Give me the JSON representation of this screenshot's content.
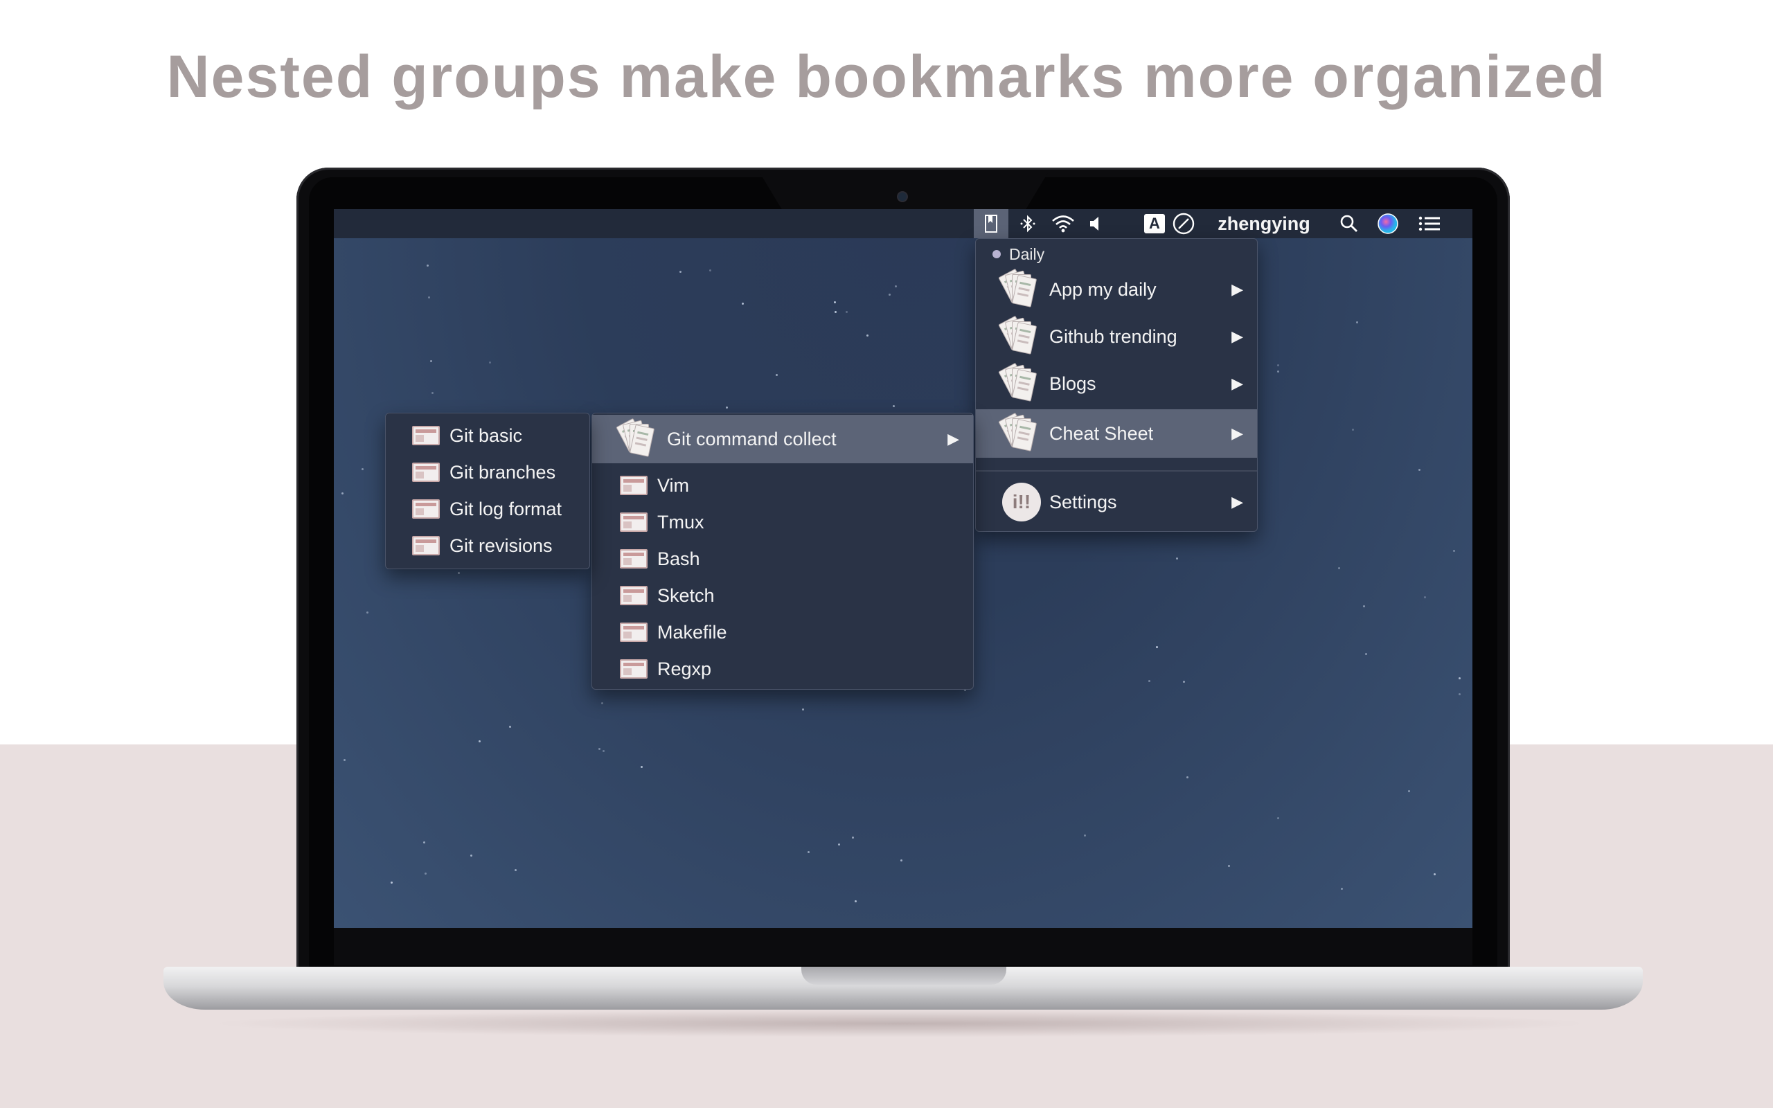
{
  "headline": "Nested groups make bookmarks more organized",
  "menubar": {
    "user": "zhengying",
    "icons": [
      "bookmark-app-icon",
      "bluetooth-icon",
      "wifi-icon",
      "volume-icon",
      "input-source-icon",
      "no-entry-icon",
      "search-icon",
      "siri-icon",
      "list-icon"
    ],
    "input_source_label": "A"
  },
  "main_menu": {
    "section": "Daily",
    "items": [
      {
        "label": "App my daily",
        "submenu": true
      },
      {
        "label": "Github trending",
        "submenu": true
      },
      {
        "label": "Blogs",
        "submenu": true
      },
      {
        "label": "Cheat Sheet",
        "submenu": true,
        "highlighted": true
      }
    ],
    "settings": {
      "label": "Settings",
      "submenu": true
    }
  },
  "cheat_sheet_menu": {
    "group": {
      "label": "Git command collect",
      "submenu": true,
      "highlighted": true
    },
    "items": [
      "Vim",
      "Tmux",
      "Bash",
      "Sketch",
      "Makefile",
      "Regxp"
    ]
  },
  "git_menu": {
    "items": [
      "Git basic",
      "Git branches",
      "Git log format",
      "Git revisions"
    ]
  },
  "arrow_glyph": "▶",
  "colors": {
    "menubar": "#222a3a",
    "menu_bg": "#2a3346",
    "highlight": "#5c6477",
    "headline": "#a69d9d",
    "floor": "#e9dfdf"
  }
}
